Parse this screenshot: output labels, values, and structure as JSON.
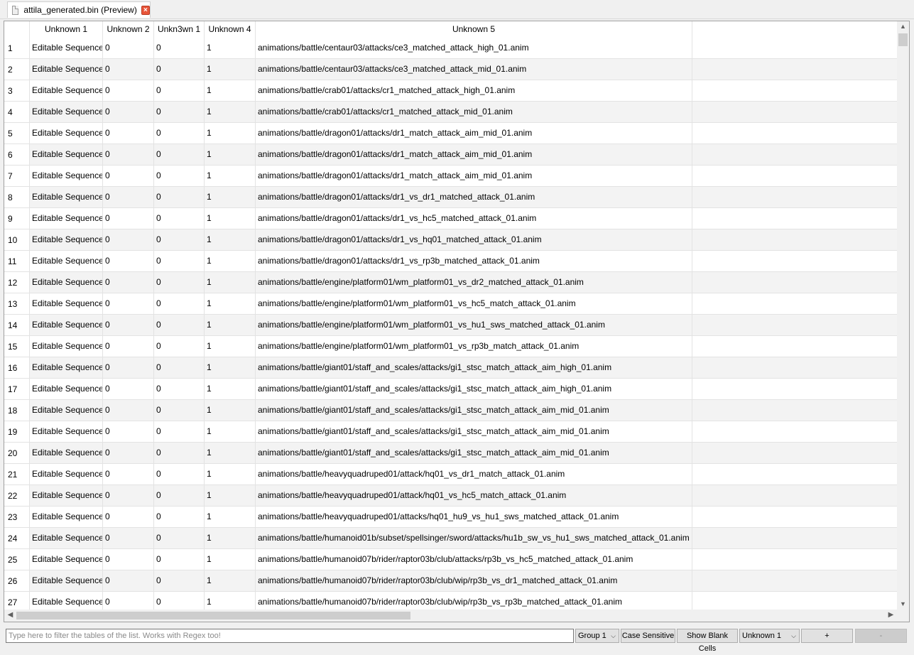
{
  "tab": {
    "title": "attila_generated.bin (Preview)",
    "close_glyph": "×"
  },
  "table": {
    "columns": [
      "",
      "Unknown 1",
      "Unknown 2",
      "Unkn3wn 1",
      "Unknown 4",
      "Unknown 5",
      ""
    ],
    "rows": [
      [
        "1",
        "Editable Sequence",
        "0",
        "0",
        "1",
        "animations/battle/centaur03/attacks/ce3_matched_attack_high_01.anim"
      ],
      [
        "2",
        "Editable Sequence",
        "0",
        "0",
        "1",
        "animations/battle/centaur03/attacks/ce3_matched_attack_mid_01.anim"
      ],
      [
        "3",
        "Editable Sequence",
        "0",
        "0",
        "1",
        "animations/battle/crab01/attacks/cr1_matched_attack_high_01.anim"
      ],
      [
        "4",
        "Editable Sequence",
        "0",
        "0",
        "1",
        "animations/battle/crab01/attacks/cr1_matched_attack_mid_01.anim"
      ],
      [
        "5",
        "Editable Sequence",
        "0",
        "0",
        "1",
        "animations/battle/dragon01/attacks/dr1_match_attack_aim_mid_01.anim"
      ],
      [
        "6",
        "Editable Sequence",
        "0",
        "0",
        "1",
        "animations/battle/dragon01/attacks/dr1_match_attack_aim_mid_01.anim"
      ],
      [
        "7",
        "Editable Sequence",
        "0",
        "0",
        "1",
        "animations/battle/dragon01/attacks/dr1_match_attack_aim_mid_01.anim"
      ],
      [
        "8",
        "Editable Sequence",
        "0",
        "0",
        "1",
        "animations/battle/dragon01/attacks/dr1_vs_dr1_matched_attack_01.anim"
      ],
      [
        "9",
        "Editable Sequence",
        "0",
        "0",
        "1",
        "animations/battle/dragon01/attacks/dr1_vs_hc5_matched_attack_01.anim"
      ],
      [
        "10",
        "Editable Sequence",
        "0",
        "0",
        "1",
        "animations/battle/dragon01/attacks/dr1_vs_hq01_matched_attack_01.anim"
      ],
      [
        "11",
        "Editable Sequence",
        "0",
        "0",
        "1",
        "animations/battle/dragon01/attacks/dr1_vs_rp3b_matched_attack_01.anim"
      ],
      [
        "12",
        "Editable Sequence",
        "0",
        "0",
        "1",
        "animations/battle/engine/platform01/wm_platform01_vs_dr2_matched_attack_01.anim"
      ],
      [
        "13",
        "Editable Sequence",
        "0",
        "0",
        "1",
        "animations/battle/engine/platform01/wm_platform01_vs_hc5_match_attack_01.anim"
      ],
      [
        "14",
        "Editable Sequence",
        "0",
        "0",
        "1",
        "animations/battle/engine/platform01/wm_platform01_vs_hu1_sws_matched_attack_01.anim"
      ],
      [
        "15",
        "Editable Sequence",
        "0",
        "0",
        "1",
        "animations/battle/engine/platform01/wm_platform01_vs_rp3b_match_attack_01.anim"
      ],
      [
        "16",
        "Editable Sequence",
        "0",
        "0",
        "1",
        "animations/battle/giant01/staff_and_scales/attacks/gi1_stsc_match_attack_aim_high_01.anim"
      ],
      [
        "17",
        "Editable Sequence",
        "0",
        "0",
        "1",
        "animations/battle/giant01/staff_and_scales/attacks/gi1_stsc_match_attack_aim_high_01.anim"
      ],
      [
        "18",
        "Editable Sequence",
        "0",
        "0",
        "1",
        "animations/battle/giant01/staff_and_scales/attacks/gi1_stsc_match_attack_aim_mid_01.anim"
      ],
      [
        "19",
        "Editable Sequence",
        "0",
        "0",
        "1",
        "animations/battle/giant01/staff_and_scales/attacks/gi1_stsc_match_attack_aim_mid_01.anim"
      ],
      [
        "20",
        "Editable Sequence",
        "0",
        "0",
        "1",
        "animations/battle/giant01/staff_and_scales/attacks/gi1_stsc_match_attack_aim_mid_01.anim"
      ],
      [
        "21",
        "Editable Sequence",
        "0",
        "0",
        "1",
        "animations/battle/heavyquadruped01/attack/hq01_vs_dr1_match_attack_01.anim"
      ],
      [
        "22",
        "Editable Sequence",
        "0",
        "0",
        "1",
        "animations/battle/heavyquadruped01/attack/hq01_vs_hc5_match_attack_01.anim"
      ],
      [
        "23",
        "Editable Sequence",
        "0",
        "0",
        "1",
        "animations/battle/heavyquadruped01/attacks/hq01_hu9_vs_hu1_sws_matched_attack_01.anim"
      ],
      [
        "24",
        "Editable Sequence",
        "0",
        "0",
        "1",
        "animations/battle/humanoid01b/subset/spellsinger/sword/attacks/hu1b_sw_vs_hu1_sws_matched_attack_01.anim"
      ],
      [
        "25",
        "Editable Sequence",
        "0",
        "0",
        "1",
        "animations/battle/humanoid07b/rider/raptor03b/club/attacks/rp3b_vs_hc5_matched_attack_01.anim"
      ],
      [
        "26",
        "Editable Sequence",
        "0",
        "0",
        "1",
        "animations/battle/humanoid07b/rider/raptor03b/club/wip/rp3b_vs_dr1_matched_attack_01.anim"
      ],
      [
        "27",
        "Editable Sequence",
        "0",
        "0",
        "1",
        "animations/battle/humanoid07b/rider/raptor03b/club/wip/rp3b_vs_rp3b_matched_attack_01.anim"
      ]
    ]
  },
  "bottom": {
    "filter_placeholder": "Type here to filter the tables of the list. Works with Regex too!",
    "group_value": "Group 1",
    "case_sensitive_label": "Case Sensitive",
    "show_blank_label": "Show Blank Cells",
    "column_value": "Unknown 1",
    "add_label": "+",
    "remove_label": "-"
  },
  "icons": {
    "file": "file-icon",
    "close": "close-icon",
    "chevron": "chevron-down-icon"
  }
}
